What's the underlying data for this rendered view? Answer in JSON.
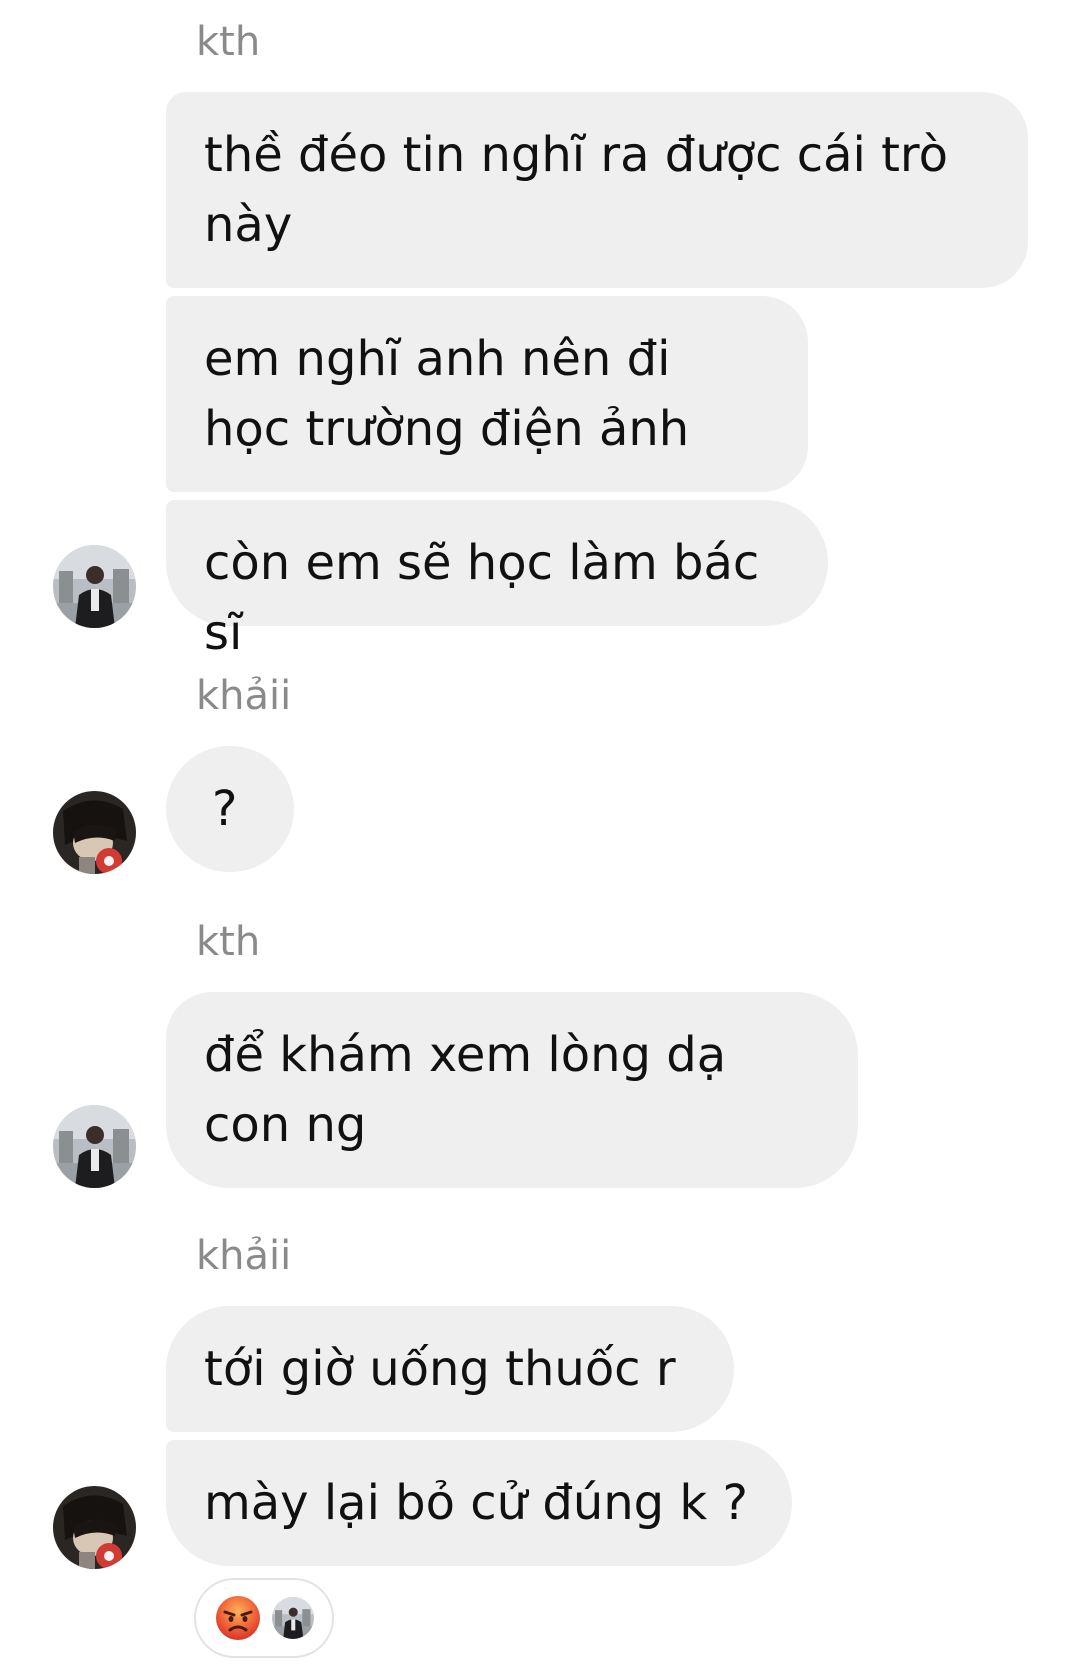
{
  "conversation": {
    "groups": [
      {
        "sender": "kth",
        "messages": [
          "thề đéo tin nghĩ ra được cái trò này",
          "em nghĩ anh nên đi học trường điện ảnh",
          "còn em sẽ học làm bác sĩ"
        ]
      },
      {
        "sender": "khảii",
        "messages": [
          "?"
        ]
      },
      {
        "sender": "kth",
        "messages": [
          "để khám xem lòng dạ con ng"
        ]
      },
      {
        "sender": "khảii",
        "messages": [
          "tới giờ uống thuốc r",
          "mày lại bỏ cử đúng k ?"
        ]
      }
    ],
    "reactions": {
      "emoji": "angry-face",
      "reactor_avatar": "kth-avatar"
    }
  },
  "colors": {
    "bubble_bg": "#efefef",
    "sender_label": "#8a8a8a",
    "text": "#111111",
    "angry_emoji": "#e8452f"
  }
}
